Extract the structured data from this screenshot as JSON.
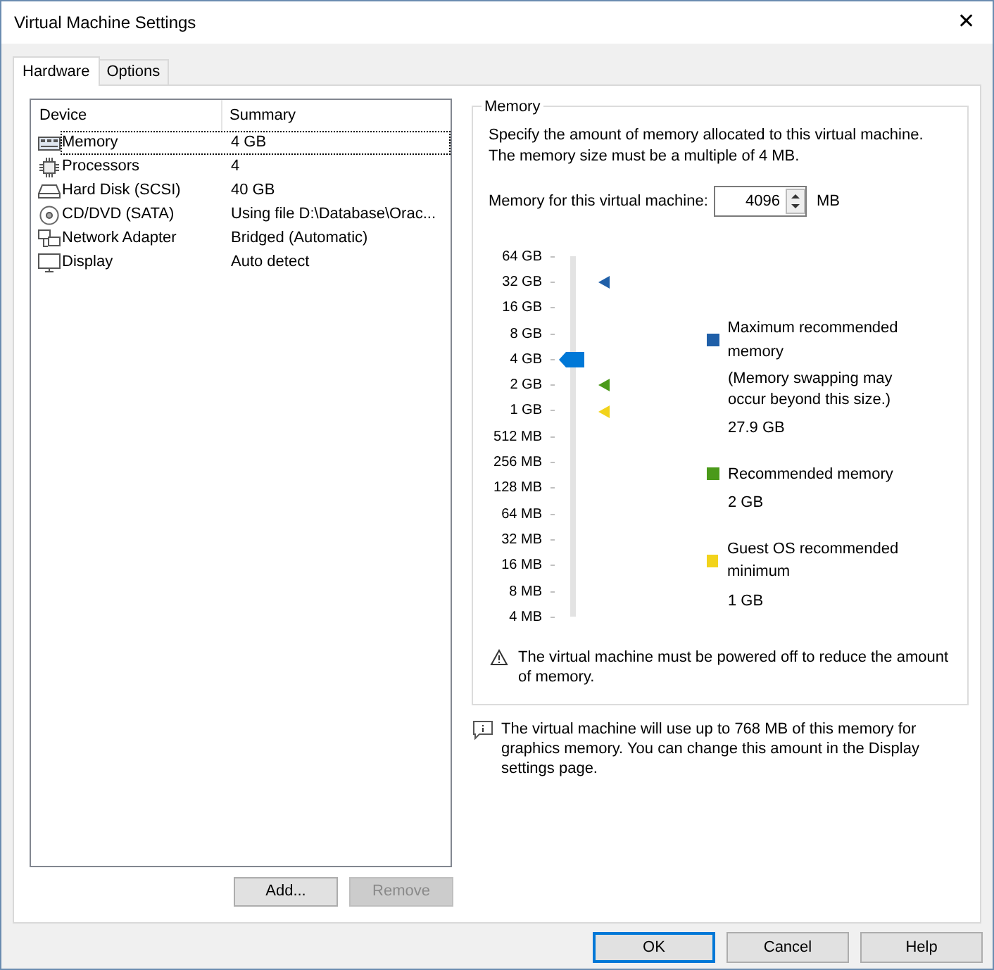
{
  "window": {
    "title": "Virtual Machine Settings",
    "close": "✕"
  },
  "tabs": [
    {
      "label": "Hardware",
      "selected": true
    },
    {
      "label": "Options",
      "selected": false
    }
  ],
  "devices": {
    "columns": [
      "Device",
      "Summary"
    ],
    "rows": [
      {
        "device": "Memory",
        "summary": "4 GB",
        "selected": true
      },
      {
        "device": "Processors",
        "summary": "4",
        "selected": false
      },
      {
        "device": "Hard Disk (SCSI)",
        "summary": "40 GB",
        "selected": false
      },
      {
        "device": "CD/DVD (SATA)",
        "summary": "Using file D:\\Database\\Orac...",
        "selected": false
      },
      {
        "device": "Network Adapter",
        "summary": "Bridged (Automatic)",
        "selected": false
      },
      {
        "device": "Display",
        "summary": "Auto detect",
        "selected": false
      }
    ]
  },
  "device_buttons": [
    {
      "label": "Add...",
      "disabled": false
    },
    {
      "label": "Remove",
      "disabled": true
    }
  ],
  "memory": {
    "title": "Memory",
    "description": "Specify the amount of memory allocated to this virtual machine. The memory size must be a multiple of 4 MB.",
    "field_label": "Memory for this virtual machine:",
    "value": "4096",
    "unit": "MB",
    "slider": {
      "labels": [
        "64 GB",
        "32 GB",
        "16 GB",
        "8 GB",
        "4 GB",
        "2 GB",
        "1 GB",
        "512 MB",
        "256 MB",
        "128 MB",
        "64 MB",
        "32 MB",
        "16 MB",
        "8 MB",
        "4 MB"
      ],
      "level": 0.714,
      "markers": [
        {
          "level": 0.929,
          "color": "#1f5fa8"
        },
        {
          "level": 0.643,
          "color": "#4b9a1a"
        },
        {
          "level": 0.571,
          "color": "#f2d31b"
        }
      ]
    },
    "legend": [
      {
        "name": "Maximum recommended memory",
        "note": "(Memory swapping may occur beyond this size.)",
        "value": "27.9 GB",
        "color": "#1f5fa8"
      },
      {
        "name": "Recommended memory",
        "value": "2 GB",
        "color": "#4b9a1a"
      },
      {
        "name": "Guest OS recommended minimum",
        "value": "1 GB",
        "color": "#f2d31b"
      }
    ],
    "warning": "The virtual machine must be powered off to reduce the amount of memory."
  },
  "info": "The virtual machine will use up to 768 MB of this memory for graphics memory. You can change this amount in the Display settings page.",
  "buttons": [
    {
      "label": "OK",
      "default": true
    },
    {
      "label": "Cancel",
      "default": false
    },
    {
      "label": "Help",
      "default": false
    }
  ]
}
